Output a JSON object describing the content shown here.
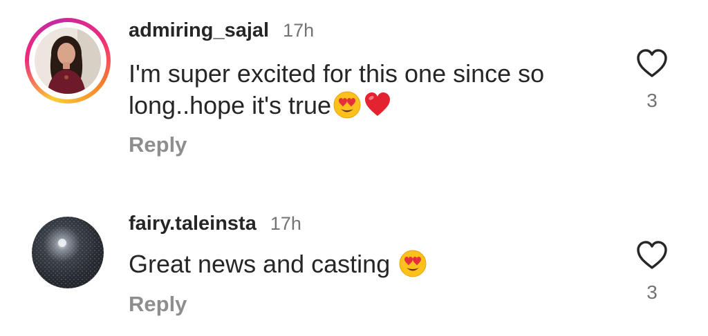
{
  "comments": [
    {
      "username": "admiring_sajal",
      "time": "17h",
      "text": "I'm super excited for this one since so long..hope it's true",
      "emojis": [
        "heart-eyes-emoji",
        "red-heart-emoji"
      ],
      "reply_label": "Reply",
      "like_count": "3",
      "has_story_ring": true
    },
    {
      "username": "fairy.taleinsta",
      "time": "17h",
      "text": "Great news and casting ",
      "emojis": [
        "heart-eyes-emoji"
      ],
      "reply_label": "Reply",
      "like_count": "3",
      "has_story_ring": false
    }
  ],
  "colors": {
    "text": "#262626",
    "secondary": "#737373",
    "reply": "#8e8e8e",
    "story_ring": [
      "#f9ce34",
      "#ee2a7b",
      "#c32aa3"
    ]
  },
  "icons": {
    "like": "heart-outline-icon"
  }
}
